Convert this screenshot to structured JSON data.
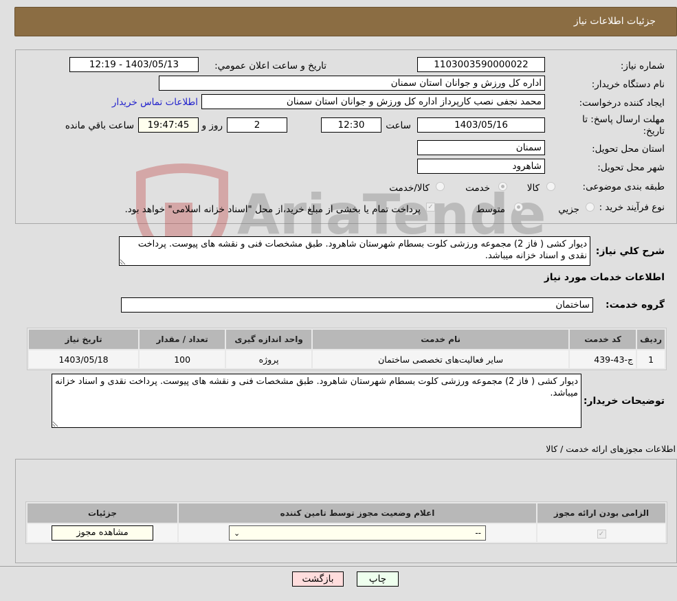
{
  "header": {
    "title": "جزئیات اطلاعات نیاز"
  },
  "form": {
    "need_number_label": "شماره نیاز:",
    "need_number": "1103003590000022",
    "announce_label": "تاریخ و ساعت اعلان عمومي:",
    "announce_value": "1403/05/13 - 12:19",
    "buyer_org_label": "نام دستگاه خریدار:",
    "buyer_org": "اداره کل ورزش و جوانان استان سمنان",
    "requester_label": "ایجاد کننده درخواست:",
    "requester": "محمد نجفی نصب کارپرداز اداره کل ورزش و جوانان استان سمنان",
    "buyer_contact_link": "اطلاعات تماس خریدار",
    "deadline_label_line1": "مهلت ارسال پاسخ: تا",
    "deadline_label_line2": "تاریخ:",
    "deadline_date": "1403/05/16",
    "time_label": "ساعت",
    "deadline_time": "12:30",
    "days_value": "2",
    "days_label": "روز و",
    "remaining_time": "19:47:45",
    "remaining_label": "ساعت باقي مانده",
    "province_label": "استان محل تحویل:",
    "province": "سمنان",
    "city_label": "شهر محل تحویل:",
    "city": "شاهرود",
    "category_label": "طبقه بندی موضوعی:",
    "category_options": [
      {
        "label": "کالا",
        "selected": false
      },
      {
        "label": "خدمت",
        "selected": true
      },
      {
        "label": "کالا/خدمت",
        "selected": false
      }
    ],
    "process_label": "نوع فرآیند خرید :",
    "process_options": [
      {
        "label": "جزيي",
        "selected": false
      },
      {
        "label": "متوسط",
        "selected": true
      }
    ],
    "treasury_checkbox_checked": true,
    "treasury_text": "پرداخت تمام یا بخشی از مبلغ خرید،از محل \"اسناد خزانه اسلامی\" خواهد بود."
  },
  "description": {
    "label": "شرح کلي نیاز:",
    "text": "دیوار کشی ( فاز 2) مجموعه ورزشی کلوت بسطام شهرستان شاهرود. طبق مشخصات فنی و نقشه های پیوست. پرداخت نقدی و اسناد خزانه میباشد."
  },
  "services": {
    "section_title": "اطلاعات خدمات مورد نیاز",
    "group_label": "گروه خدمت:",
    "group_value": "ساختمان",
    "columns": [
      "ردیف",
      "کد خدمت",
      "نام خدمت",
      "واحد اندازه گیری",
      "تعداد / مقدار",
      "تاریخ نیاز"
    ],
    "rows": [
      [
        "1",
        "ج-43-439",
        "سایر فعالیت‌های تخصصی ساختمان",
        "پروژه",
        "100",
        "1403/05/18"
      ]
    ]
  },
  "buyer_notes": {
    "label": "توضیحات خریدار:",
    "text": "دیوار کشی ( فاز 2) مجموعه ورزشی کلوت بسطام شهرستان شاهرود. طبق مشخصات فنی و نقشه های پیوست. پرداخت نقدی و اسناد خزانه میباشد."
  },
  "permits": {
    "section_title": "اطلاعات مجوزهای ارائه خدمت / کالا",
    "columns": [
      "الزامی بودن ارائه مجوز",
      "اعلام وضعیت مجوز توسط تامین کننده",
      "جزئیات"
    ],
    "row": {
      "required_checked": true,
      "status_selected": "--",
      "details_button": "مشاهده مجوز"
    }
  },
  "actions": {
    "print": "چاپ",
    "back": "بازگشت",
    "print_bg": "#eeffee",
    "back_bg": "#ffdddd"
  },
  "watermark": {
    "text": "AriaTender.neT"
  }
}
